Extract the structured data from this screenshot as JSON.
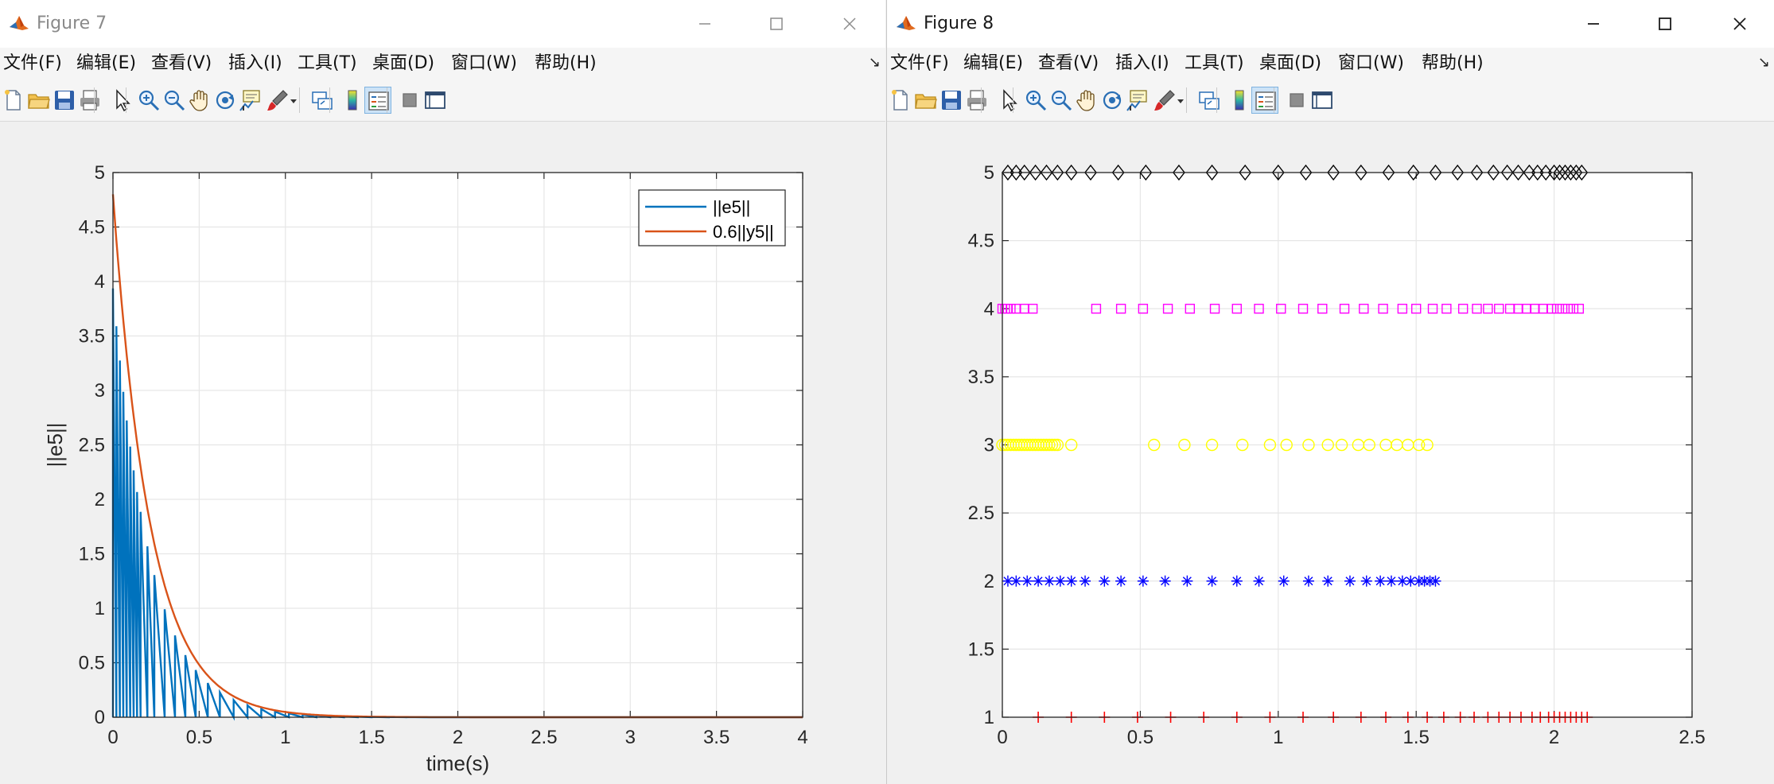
{
  "figure7": {
    "title": "Figure 7",
    "menu": [
      "文件(F)",
      "编辑(E)",
      "查看(V)",
      "插入(I)",
      "工具(T)",
      "桌面(D)",
      "窗口(W)",
      "帮助(H)"
    ],
    "toolbar_icons": [
      "new-file-icon",
      "open-folder-icon",
      "save-icon",
      "print-icon",
      "pointer-icon",
      "zoom-in-icon",
      "zoom-out-icon",
      "pan-hand-icon",
      "rotate-3d-icon",
      "data-tips-icon",
      "brush-icon",
      "link-plot-icon",
      "colorbar-icon",
      "legend-icon",
      "hide-plot-tools-icon",
      "show-plot-tools-icon"
    ],
    "colors": {
      "e5": "#0072BD",
      "y5": "#D95319"
    }
  },
  "figure8": {
    "title": "Figure 8",
    "menu": [
      "文件(F)",
      "编辑(E)",
      "查看(V)",
      "插入(I)",
      "工具(T)",
      "桌面(D)",
      "窗口(W)",
      "帮助(H)"
    ],
    "toolbar_icons": [
      "new-file-icon",
      "open-folder-icon",
      "save-icon",
      "print-icon",
      "pointer-icon",
      "zoom-in-icon",
      "zoom-out-icon",
      "pan-hand-icon",
      "rotate-3d-icon",
      "data-tips-icon",
      "brush-icon",
      "link-plot-icon",
      "colorbar-icon",
      "legend-icon",
      "hide-plot-tools-icon",
      "show-plot-tools-icon"
    ]
  },
  "chart_data": [
    {
      "type": "line",
      "xlabel": "time(s)",
      "ylabel": "||e5||",
      "xlim": [
        0,
        4
      ],
      "ylim": [
        0,
        5
      ],
      "xticks": [
        "0",
        "0.5",
        "1",
        "1.5",
        "2",
        "2.5",
        "3",
        "3.5",
        "4"
      ],
      "yticks": [
        "0",
        "0.5",
        "1",
        "1.5",
        "2",
        "2.5",
        "3",
        "3.5",
        "4",
        "4.5",
        "5"
      ],
      "grid": true,
      "legend_position": "top-right",
      "series": [
        {
          "name": "||e5||",
          "color": "#0072BD",
          "kind": "sawtooth",
          "event_times": [
            0,
            0.02,
            0.04,
            0.06,
            0.08,
            0.1,
            0.12,
            0.14,
            0.16,
            0.2,
            0.24,
            0.3,
            0.36,
            0.42,
            0.48,
            0.55,
            0.62,
            0.7,
            0.78,
            0.86,
            0.94,
            1.02,
            1.1,
            1.18,
            1.26,
            1.34,
            1.42,
            1.5,
            1.6,
            1.7,
            1.8
          ]
        },
        {
          "name": "0.6||y5||",
          "color": "#D95319",
          "kind": "exponential",
          "y0": 4.8,
          "decay_rate": 4.6
        }
      ]
    },
    {
      "type": "scatter",
      "xlim": [
        0,
        2.5
      ],
      "ylim": [
        1,
        5
      ],
      "xticks": [
        "0",
        "0.5",
        "1",
        "1.5",
        "2",
        "2.5"
      ],
      "yticks": [
        "1",
        "1.5",
        "2",
        "2.5",
        "3",
        "3.5",
        "4",
        "4.5",
        "5"
      ],
      "grid": true,
      "series": [
        {
          "y": 5,
          "marker": "diamond",
          "color": "#000000",
          "x": [
            0.02,
            0.05,
            0.08,
            0.12,
            0.16,
            0.2,
            0.25,
            0.32,
            0.42,
            0.52,
            0.64,
            0.76,
            0.88,
            1.0,
            1.1,
            1.2,
            1.3,
            1.4,
            1.49,
            1.57,
            1.65,
            1.72,
            1.78,
            1.83,
            1.87,
            1.91,
            1.94,
            1.97,
            2.0,
            2.02,
            2.04,
            2.06,
            2.08,
            2.1
          ]
        },
        {
          "y": 4,
          "marker": "square",
          "color": "#FF00FF",
          "x": [
            0.0,
            0.01,
            0.02,
            0.03,
            0.05,
            0.08,
            0.11,
            0.34,
            0.43,
            0.51,
            0.6,
            0.68,
            0.77,
            0.85,
            0.93,
            1.01,
            1.09,
            1.16,
            1.24,
            1.31,
            1.38,
            1.45,
            1.5,
            1.56,
            1.61,
            1.67,
            1.72,
            1.76,
            1.8,
            1.84,
            1.87,
            1.9,
            1.93,
            1.96,
            1.99,
            2.01,
            2.03,
            2.05,
            2.07,
            2.09
          ]
        },
        {
          "y": 3,
          "marker": "circle",
          "color": "#FFFF00",
          "x": [
            0.0,
            0.01,
            0.02,
            0.03,
            0.04,
            0.05,
            0.06,
            0.07,
            0.08,
            0.09,
            0.1,
            0.11,
            0.12,
            0.13,
            0.14,
            0.15,
            0.16,
            0.17,
            0.18,
            0.19,
            0.2,
            0.25,
            0.55,
            0.66,
            0.76,
            0.87,
            0.97,
            1.03,
            1.11,
            1.18,
            1.23,
            1.29,
            1.33,
            1.39,
            1.43,
            1.47,
            1.51,
            1.54
          ]
        },
        {
          "y": 2,
          "marker": "asterisk",
          "color": "#0000FF",
          "x": [
            0.02,
            0.05,
            0.09,
            0.13,
            0.17,
            0.21,
            0.25,
            0.3,
            0.37,
            0.43,
            0.51,
            0.59,
            0.67,
            0.76,
            0.85,
            0.93,
            1.02,
            1.11,
            1.18,
            1.26,
            1.32,
            1.37,
            1.41,
            1.45,
            1.48,
            1.51,
            1.53,
            1.55,
            1.57
          ]
        },
        {
          "y": 1,
          "marker": "plus",
          "color": "#FF0000",
          "x": [
            0.13,
            0.25,
            0.37,
            0.49,
            0.61,
            0.73,
            0.85,
            0.97,
            1.09,
            1.2,
            1.3,
            1.39,
            1.47,
            1.54,
            1.6,
            1.66,
            1.71,
            1.76,
            1.8,
            1.84,
            1.88,
            1.92,
            1.95,
            1.98,
            2.0,
            2.02,
            2.04,
            2.06,
            2.08,
            2.1,
            2.12
          ]
        }
      ]
    }
  ]
}
